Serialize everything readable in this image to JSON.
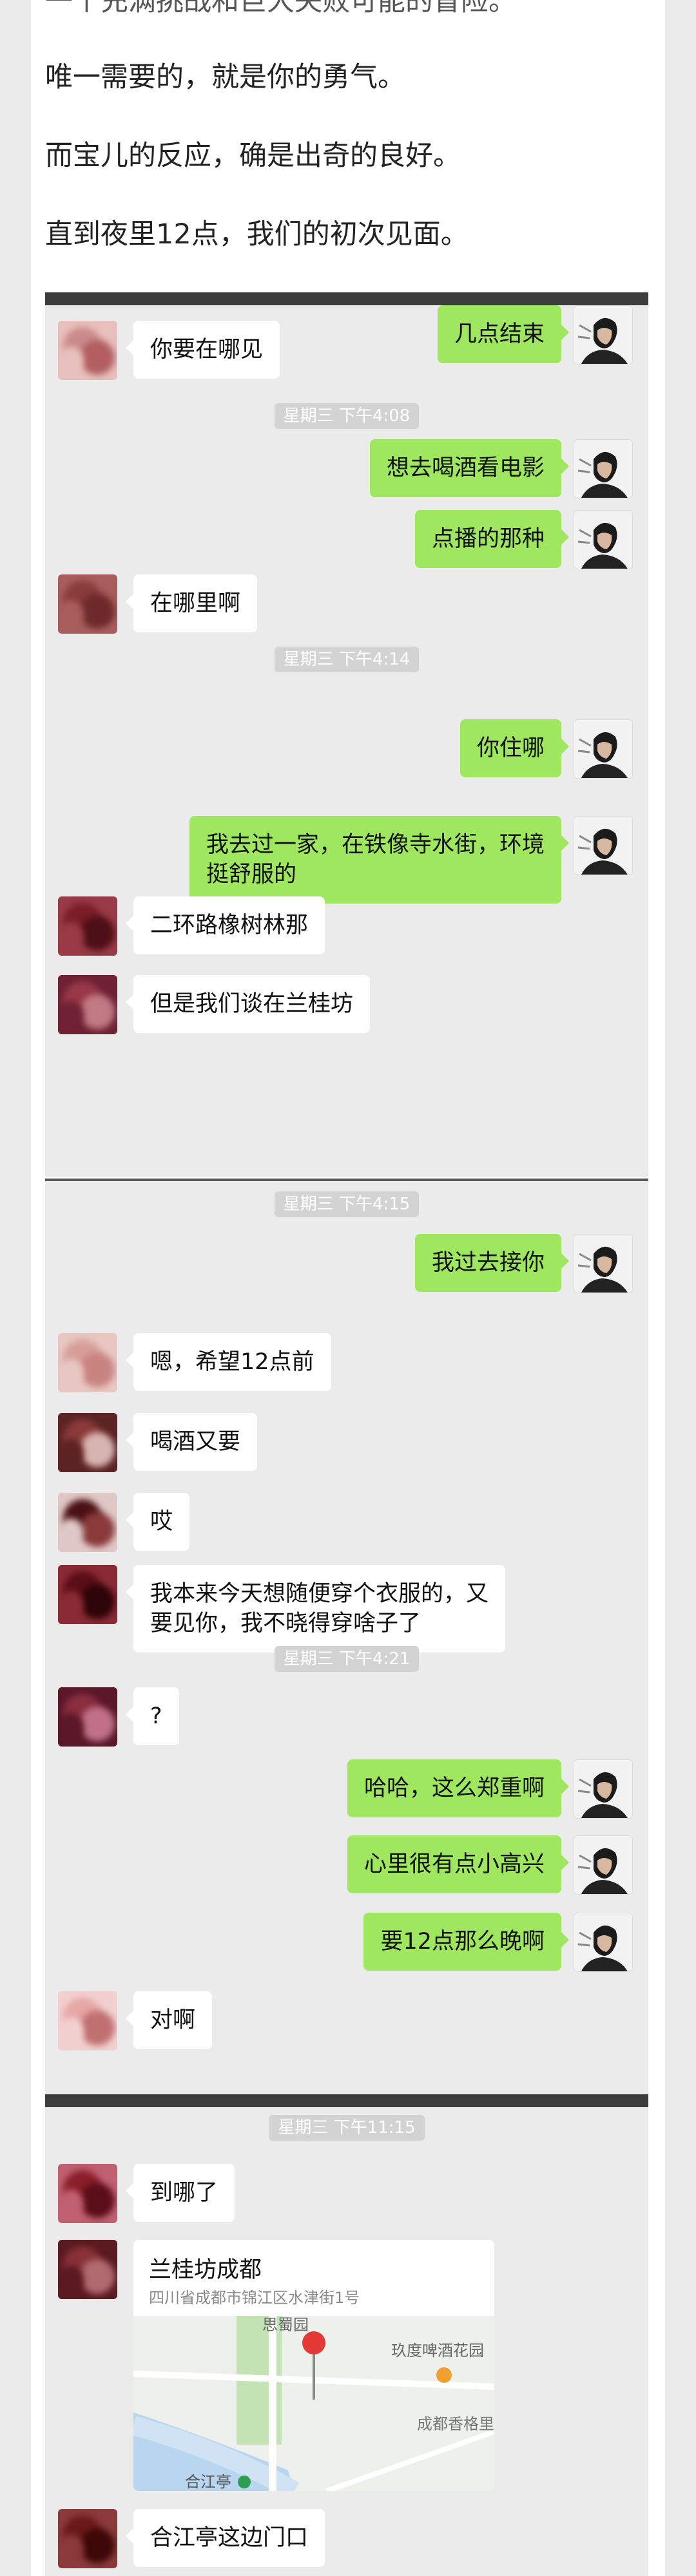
{
  "article": {
    "paragraphs": [
      "一个充满挑战和巨大失败可能的冒险。",
      "唯一需要的，就是你的勇气。",
      "而宝儿的反应，确是出奇的良好。",
      "直到夜里12点，我们的初次见面。"
    ]
  },
  "screenshots": [
    {
      "items": [
        {
          "kind": "msg",
          "side": "left",
          "text": "你要在哪见"
        },
        {
          "kind": "time",
          "text": "星期三 下午4:08"
        },
        {
          "kind": "msg",
          "side": "right",
          "text": "想去喝酒看电影"
        },
        {
          "kind": "msg",
          "side": "right",
          "text": "点播的那种"
        },
        {
          "kind": "msg",
          "side": "left",
          "text": "在哪里啊"
        },
        {
          "kind": "time",
          "text": "星期三 下午4:14"
        },
        {
          "kind": "msg",
          "side": "right",
          "text": "你住哪"
        },
        {
          "kind": "msg",
          "side": "right",
          "text": "我去过一家，在铁像寺水街，环境\n挺舒服的"
        },
        {
          "kind": "msg",
          "side": "left",
          "text": "二环路橡树林那"
        },
        {
          "kind": "msg",
          "side": "left",
          "text": "但是我们谈在兰桂坊"
        },
        {
          "kind": "msg",
          "side": "right",
          "text": "几点结束"
        }
      ]
    },
    {
      "items": [
        {
          "kind": "time",
          "text": "星期三 下午4:15"
        },
        {
          "kind": "msg",
          "side": "right",
          "text": "我过去接你"
        },
        {
          "kind": "msg",
          "side": "left",
          "text": "嗯，希望12点前"
        },
        {
          "kind": "msg",
          "side": "left",
          "text": "喝酒又要"
        },
        {
          "kind": "msg",
          "side": "left",
          "text": "哎"
        },
        {
          "kind": "msg",
          "side": "left",
          "text": "我本来今天想随便穿个衣服的，又\n要见你，我不晓得穿啥子了"
        },
        {
          "kind": "time",
          "text": "星期三 下午4:21"
        },
        {
          "kind": "msg",
          "side": "left",
          "text": "?"
        },
        {
          "kind": "msg",
          "side": "right",
          "text": "哈哈，这么郑重啊"
        },
        {
          "kind": "msg",
          "side": "right",
          "text": "心里很有点小高兴"
        },
        {
          "kind": "msg",
          "side": "right",
          "text": "要12点那么晚啊"
        },
        {
          "kind": "msg",
          "side": "left",
          "text": "对啊"
        }
      ]
    },
    {
      "items": [
        {
          "kind": "time",
          "text": "星期三 下午11:15"
        },
        {
          "kind": "msg",
          "side": "left",
          "text": "到哪了"
        },
        {
          "kind": "location",
          "side": "left",
          "name": "兰桂坊成都",
          "address": "四川省成都市锦江区水津街1号",
          "map_labels": [
            "思蜀园",
            "玖度啤酒花园",
            "成都香格里拉大酒店",
            "合江亭"
          ]
        },
        {
          "kind": "msg",
          "side": "left",
          "text": "合江亭这边门口"
        }
      ]
    }
  ],
  "colors": {
    "sent_bubble": "#9fe75e",
    "received_bubble": "#ffffff",
    "chat_background": "#ebebeb",
    "timestamp_pill": "#d3d3d3",
    "map_pin": "#e53935"
  },
  "icons": {
    "map_pin": "location-pin-icon",
    "avatar_self": "avatar-self",
    "avatar_other": "avatar-other"
  }
}
